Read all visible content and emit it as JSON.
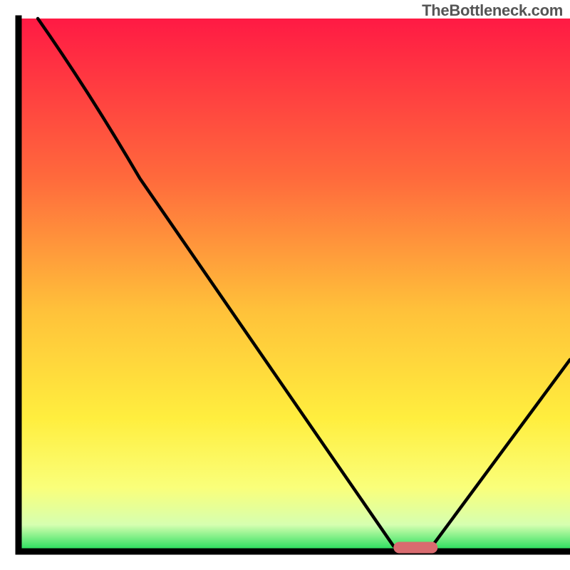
{
  "watermark": "TheBottleneck.com",
  "chart_data": {
    "type": "line",
    "title": "",
    "xlabel": "",
    "ylabel": "",
    "xlim": [
      0,
      100
    ],
    "ylim": [
      0,
      100
    ],
    "curve": {
      "name": "bottleneck-curve",
      "points": [
        {
          "x": 3.5,
          "y": 100
        },
        {
          "x": 22,
          "y": 70
        },
        {
          "x": 68,
          "y": 1
        },
        {
          "x": 75,
          "y": 1
        },
        {
          "x": 100,
          "y": 36
        }
      ]
    },
    "marker": {
      "x": 72,
      "y": 1,
      "width": 8,
      "color": "#d96b6f"
    },
    "gradient_stops": [
      {
        "offset": 0,
        "color": "#ff1a44"
      },
      {
        "offset": 30,
        "color": "#ff6a3c"
      },
      {
        "offset": 55,
        "color": "#ffc23a"
      },
      {
        "offset": 75,
        "color": "#ffee3e"
      },
      {
        "offset": 88,
        "color": "#faff7a"
      },
      {
        "offset": 95,
        "color": "#d6ffb0"
      },
      {
        "offset": 100,
        "color": "#1bdc57"
      }
    ],
    "axis_color": "#000000"
  }
}
